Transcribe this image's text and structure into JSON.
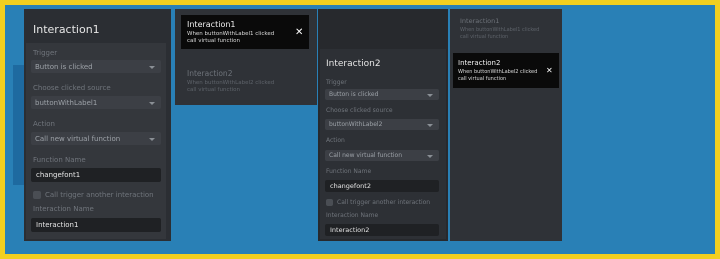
{
  "left": {
    "title": "Interaction1",
    "trigger_label": "Trigger",
    "trigger_value": "Button is clicked",
    "source_label": "Choose clicked source",
    "source_value": "buttonWithLabel1",
    "action_label": "Action",
    "action_value": "Call new virtual function",
    "function_label": "Function Name",
    "function_value": "changefont1",
    "checkbox_label": "Call trigger another interaction",
    "interaction_label": "Interaction Name",
    "interaction_value": "Interaction1"
  },
  "mid": {
    "card_title": "Interaction1",
    "card_line1": "When buttonWithLabel1 clicked",
    "card_line2": "call virtual function",
    "ghost_title": "Interaction2",
    "ghost_line1": "When buttonWithLabel2 clicked",
    "ghost_line2": "call virtual function"
  },
  "right": {
    "title": "Interaction2",
    "trigger_label": "Trigger",
    "trigger_value": "Button is clicked",
    "source_label": "Choose clicked source",
    "source_value": "buttonWithLabel2",
    "action_label": "Action",
    "action_value": "Call new virtual function",
    "function_label": "Function Name",
    "function_value": "changefont2",
    "checkbox_label": "Call trigger another interaction",
    "interaction_label": "Interaction Name",
    "interaction_value": "Interaction2"
  },
  "list2": {
    "ghost_title": "Interaction1",
    "ghost_line1": "When buttonWithLabel1 clicked",
    "ghost_line2": "call virtual function",
    "card_title": "Interaction2",
    "card_line1": "When buttonWithLabel2 clicked",
    "card_line2": "call virtual function"
  },
  "close_glyph": "✕"
}
